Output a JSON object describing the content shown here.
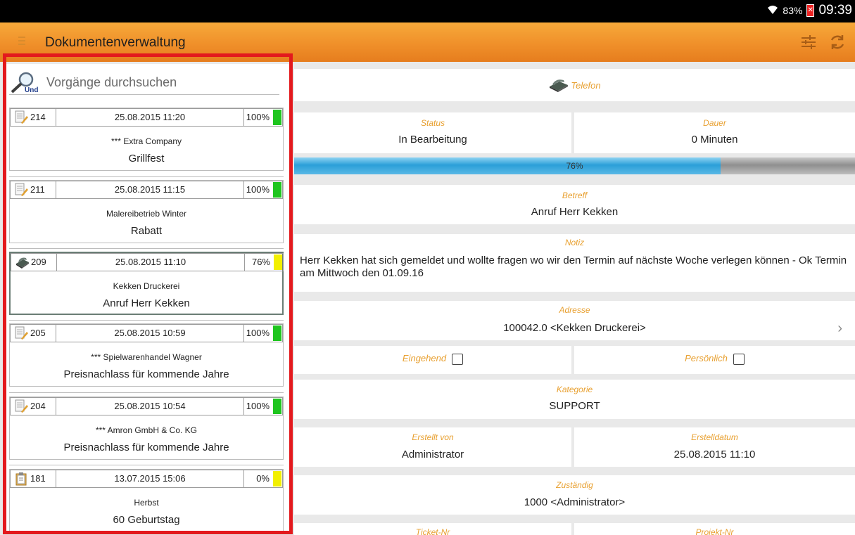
{
  "status_bar": {
    "battery": "83%",
    "time": "09:39"
  },
  "app_bar": {
    "title": "Dokumentenverwaltung"
  },
  "search": {
    "placeholder": "Vorgänge durchsuchen",
    "icon_label": "Und"
  },
  "list": [
    {
      "id": "214",
      "date": "25.08.2015 11:20",
      "percent": "100%",
      "status_color": "#1ec51e",
      "company": "*** Extra Company",
      "subject": "Grillfest",
      "icon": "document-edit-icon"
    },
    {
      "id": "211",
      "date": "25.08.2015 11:15",
      "percent": "100%",
      "status_color": "#1ec51e",
      "company": "Malereibetrieb Winter",
      "subject": "Rabatt",
      "icon": "document-edit-icon"
    },
    {
      "id": "209",
      "date": "25.08.2015 11:10",
      "percent": "76%",
      "status_color": "#f2ef00",
      "company": "Kekken Druckerei",
      "subject": "Anruf Herr Kekken",
      "icon": "telephone-icon"
    },
    {
      "id": "205",
      "date": "25.08.2015 10:59",
      "percent": "100%",
      "status_color": "#1ec51e",
      "company": "*** Spielwarenhandel Wagner",
      "subject": "Preisnachlass für kommende Jahre",
      "icon": "document-edit-icon"
    },
    {
      "id": "204",
      "date": "25.08.2015 10:54",
      "percent": "100%",
      "status_color": "#1ec51e",
      "company": "*** Amron GmbH & Co. KG",
      "subject": "Preisnachlass für kommende Jahre",
      "icon": "document-edit-icon"
    },
    {
      "id": "181",
      "date": "13.07.2015 15:06",
      "percent": "0%",
      "status_color": "#f2ef00",
      "company": "Herbst",
      "subject": "60 Geburtstag",
      "icon": "clipboard-icon"
    }
  ],
  "detail": {
    "type_label": "Telefon",
    "status": {
      "label": "Status",
      "value": "In Bearbeitung"
    },
    "dauer": {
      "label": "Dauer",
      "value": "0 Minuten"
    },
    "progress": {
      "value": 0.76,
      "text": "76%"
    },
    "betreff": {
      "label": "Betreff",
      "value": "Anruf Herr Kekken"
    },
    "notiz": {
      "label": "Notiz",
      "value": "Herr Kekken hat sich gemeldet und wollte fragen wo wir den Termin auf nächste Woche verlegen können - Ok Termin am Mittwoch den 01.09.16"
    },
    "adresse": {
      "label": "Adresse",
      "value": "100042.0 <Kekken Druckerei>"
    },
    "eingehend": {
      "label": "Eingehend",
      "checked": false
    },
    "persoenlich": {
      "label": "Persönlich",
      "checked": false
    },
    "kategorie": {
      "label": "Kategorie",
      "value": "SUPPORT"
    },
    "erstellt_von": {
      "label": "Erstellt von",
      "value": "Administrator"
    },
    "erstelldatum": {
      "label": "Erstelldatum",
      "value": "25.08.2015 11:10"
    },
    "zustaendig": {
      "label": "Zuständig",
      "value": "1000 <Administrator>"
    },
    "ticket_nr": {
      "label": "Ticket-Nr"
    },
    "projekt_nr": {
      "label": "Projekt-Nr"
    }
  },
  "colors": {
    "accent": "#f0902a",
    "label": "#e8a030",
    "highlight_frame": "#e3191d",
    "progress": "#2b9fd8"
  }
}
